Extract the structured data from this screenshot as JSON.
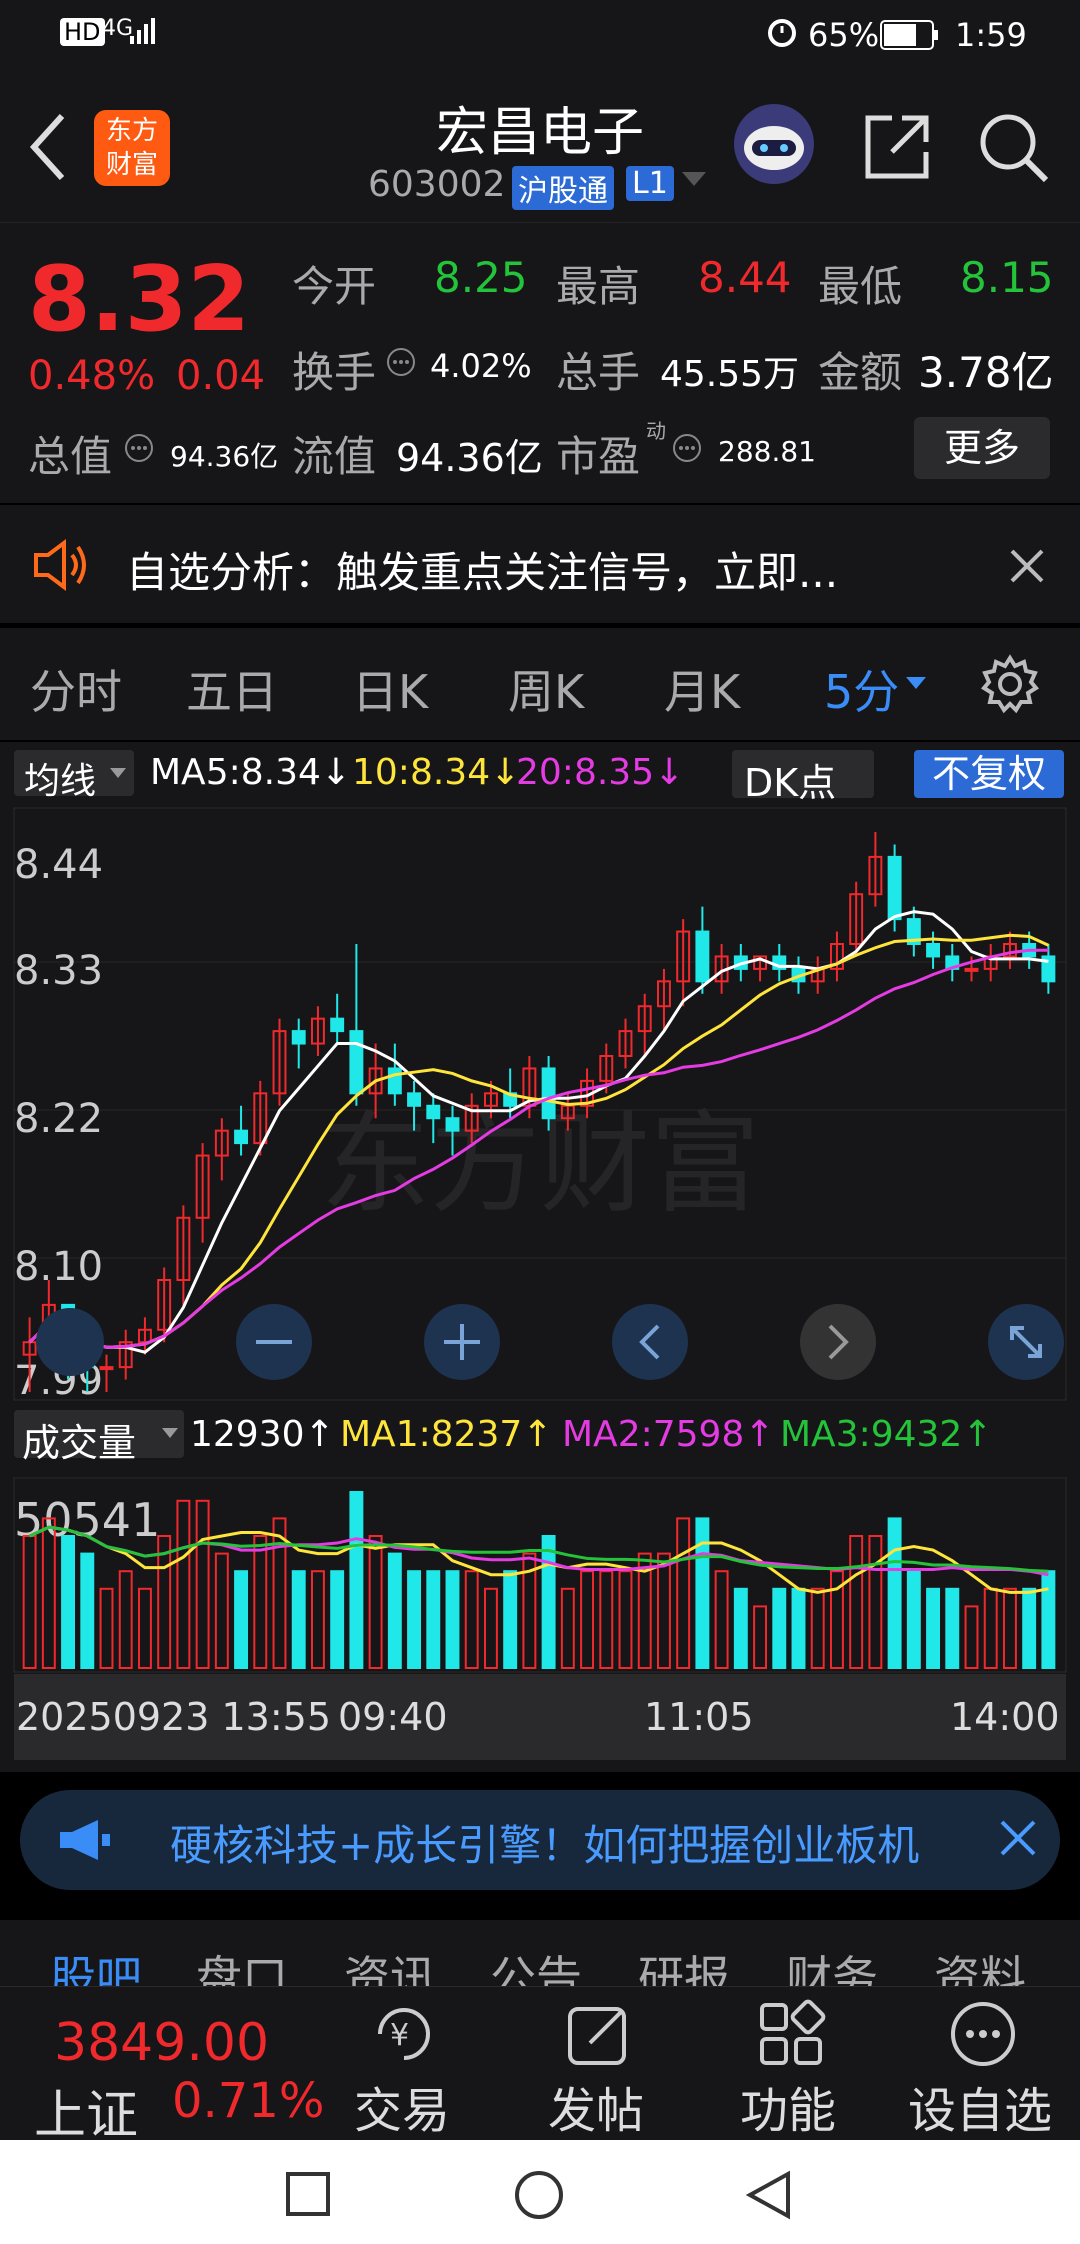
{
  "status": {
    "signal": "4G",
    "hd": "HD",
    "battery": "65%",
    "time": "1:59"
  },
  "header": {
    "logo_line1": "东方",
    "logo_line2": "财富",
    "title": "宏昌电子",
    "code": "603002",
    "tag1": "沪股通",
    "tag2": "L1"
  },
  "quote": {
    "price": "8.32",
    "pct": "0.48%",
    "chg": "0.04",
    "open_label": "今开",
    "open": "8.25",
    "high_label": "最高",
    "high": "8.44",
    "low_label": "最低",
    "low": "8.15",
    "turnover_label": "换手",
    "turnover": "4.02%",
    "volume_label": "总手",
    "volume": "45.55万",
    "amount_label": "金额",
    "amount": "3.78亿",
    "mcap_label": "总值",
    "mcap": "94.36亿",
    "float_label": "流值",
    "float": "94.36亿",
    "pe_label": "市盈",
    "pe_sup": "动",
    "pe": "288.81",
    "more": "更多"
  },
  "notice": {
    "text": "自选分析：触发重点关注信号，立即..."
  },
  "tabs": [
    "分时",
    "五日",
    "日K",
    "周K",
    "月K",
    "5分"
  ],
  "chart": {
    "ind_label": "均线",
    "ma5": "MA5:8.34↓",
    "ma10": "10:8.34↓",
    "ma20": "20:8.35↓",
    "dk": "DK点",
    "fq": "不复权",
    "y_labels": [
      "8.44",
      "8.33",
      "8.22",
      "8.10",
      "7.99"
    ],
    "watermark": "东方财富",
    "vol_label": "成交量",
    "vol_val": "12930↑",
    "vma1": "MA1:8237↑",
    "vma2": "MA2:7598↑",
    "vma3": "MA3:9432↑",
    "vol_max": "50541",
    "x_labels": [
      "20250923 13:55",
      "09:40",
      "11:05",
      "14:00"
    ]
  },
  "chart_data": {
    "type": "candlestick",
    "ylim": [
      7.99,
      8.44
    ],
    "candles_ohlc": [
      [
        8.02,
        8.05,
        7.99,
        8.03
      ],
      [
        8.03,
        8.08,
        8.01,
        8.06
      ],
      [
        8.06,
        8.06,
        8.0,
        8.02
      ],
      [
        8.02,
        8.04,
        7.99,
        8.01
      ],
      [
        8.01,
        8.02,
        7.99,
        8.01
      ],
      [
        8.01,
        8.04,
        8.0,
        8.03
      ],
      [
        8.03,
        8.05,
        8.02,
        8.04
      ],
      [
        8.04,
        8.09,
        8.03,
        8.08
      ],
      [
        8.08,
        8.14,
        8.06,
        8.13
      ],
      [
        8.13,
        8.19,
        8.11,
        8.18
      ],
      [
        8.18,
        8.21,
        8.16,
        8.2
      ],
      [
        8.2,
        8.22,
        8.18,
        8.19
      ],
      [
        8.19,
        8.24,
        8.18,
        8.23
      ],
      [
        8.23,
        8.29,
        8.22,
        8.28
      ],
      [
        8.28,
        8.29,
        8.25,
        8.27
      ],
      [
        8.27,
        8.3,
        8.26,
        8.29
      ],
      [
        8.29,
        8.31,
        8.27,
        8.28
      ],
      [
        8.28,
        8.35,
        8.22,
        8.23
      ],
      [
        8.23,
        8.27,
        8.21,
        8.25
      ],
      [
        8.25,
        8.27,
        8.22,
        8.23
      ],
      [
        8.23,
        8.24,
        8.2,
        8.22
      ],
      [
        8.22,
        8.23,
        8.19,
        8.21
      ],
      [
        8.21,
        8.22,
        8.18,
        8.2
      ],
      [
        8.2,
        8.23,
        8.19,
        8.22
      ],
      [
        8.22,
        8.24,
        8.21,
        8.23
      ],
      [
        8.23,
        8.25,
        8.21,
        8.22
      ],
      [
        8.22,
        8.26,
        8.21,
        8.25
      ],
      [
        8.25,
        8.26,
        8.2,
        8.21
      ],
      [
        8.21,
        8.23,
        8.2,
        8.22
      ],
      [
        8.22,
        8.25,
        8.21,
        8.24
      ],
      [
        8.24,
        8.27,
        8.23,
        8.26
      ],
      [
        8.26,
        8.29,
        8.25,
        8.28
      ],
      [
        8.28,
        8.31,
        8.26,
        8.3
      ],
      [
        8.3,
        8.33,
        8.28,
        8.32
      ],
      [
        8.32,
        8.37,
        8.3,
        8.36
      ],
      [
        8.36,
        8.38,
        8.31,
        8.32
      ],
      [
        8.32,
        8.35,
        8.31,
        8.34
      ],
      [
        8.34,
        8.35,
        8.32,
        8.33
      ],
      [
        8.33,
        8.34,
        8.32,
        8.34
      ],
      [
        8.34,
        8.35,
        8.32,
        8.33
      ],
      [
        8.33,
        8.34,
        8.31,
        8.32
      ],
      [
        8.32,
        8.34,
        8.31,
        8.33
      ],
      [
        8.33,
        8.36,
        8.32,
        8.35
      ],
      [
        8.35,
        8.4,
        8.34,
        8.39
      ],
      [
        8.39,
        8.44,
        8.38,
        8.42
      ],
      [
        8.42,
        8.43,
        8.36,
        8.37
      ],
      [
        8.37,
        8.38,
        8.34,
        8.35
      ],
      [
        8.35,
        8.36,
        8.33,
        8.34
      ],
      [
        8.34,
        8.35,
        8.32,
        8.33
      ],
      [
        8.33,
        8.34,
        8.32,
        8.33
      ],
      [
        8.33,
        8.35,
        8.32,
        8.34
      ],
      [
        8.34,
        8.36,
        8.33,
        8.35
      ],
      [
        8.35,
        8.36,
        8.33,
        8.34
      ],
      [
        8.34,
        8.35,
        8.31,
        8.32
      ]
    ],
    "volume_max": 50541
  },
  "banner": {
    "text": "硬核科技+成长引擎！如何把握创业板机"
  },
  "subtabs": [
    "股吧",
    "盘口",
    "资讯",
    "公告",
    "研报",
    "财务",
    "资料"
  ],
  "bottom": {
    "index_value": "3849.00",
    "index_name": "上证",
    "index_pct": "0.71%",
    "trade": "交易",
    "post": "发帖",
    "func": "功能",
    "fav": "设自选"
  },
  "colors": {
    "up": "#f0292d",
    "down": "#21e8e8",
    "bg": "#161618",
    "accent": "#3a8cf7"
  }
}
